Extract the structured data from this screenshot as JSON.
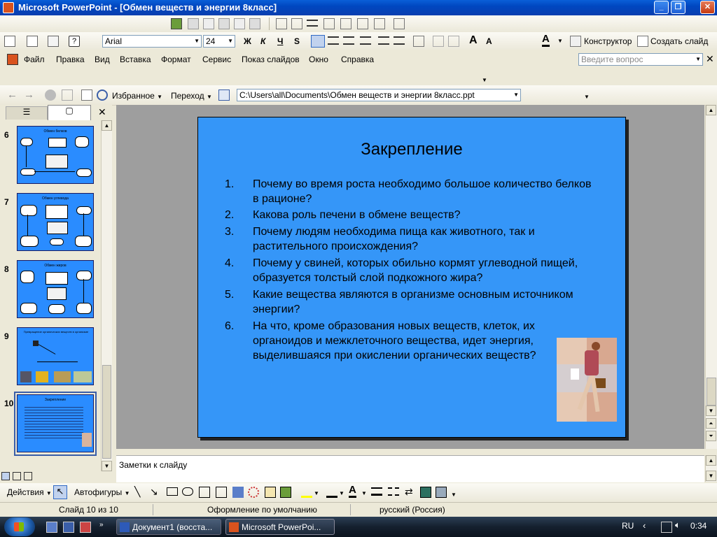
{
  "window": {
    "title": "Microsoft PowerPoint - [Обмен веществ и энергии 8класс]",
    "minimize": "_",
    "restore": "❐",
    "close": "✕"
  },
  "format": {
    "font": "Arial",
    "size": "24",
    "bold": "Ж",
    "italic": "К",
    "underline": "Ч",
    "shadow": "S",
    "design_label": "Конструктор",
    "new_slide_label": "Создать слайд"
  },
  "menu": {
    "items": [
      "Файл",
      "Правка",
      "Вид",
      "Вставка",
      "Формат",
      "Сервис",
      "Показ слайдов",
      "Окно",
      "Справка"
    ],
    "help_placeholder": "Введите вопрос"
  },
  "web": {
    "favorites": "Избранное",
    "go": "Переход",
    "address": "C:\\Users\\all\\Documents\\Обмен веществ и энергии 8класс.ppt"
  },
  "thumbnails": [
    {
      "num": "6",
      "title": "Обмен белков"
    },
    {
      "num": "7",
      "title": "Обмен углевода"
    },
    {
      "num": "8",
      "title": "Обмен жиров"
    },
    {
      "num": "9",
      "title": "Превращение органических веществ в организме"
    },
    {
      "num": "10",
      "title": "Закрепление"
    }
  ],
  "slide": {
    "title": "Закрепление",
    "questions": [
      {
        "num": "1.",
        "text": "Почему во время роста необходимо большое количество белков в рационе?"
      },
      {
        "num": "2.",
        "text": "Какова роль печени в обмене веществ?"
      },
      {
        "num": "3.",
        "text": "Почему людям необходима пища как животного, так и растительного происхождения?"
      },
      {
        "num": "4.",
        "text": "Почему у свиней, которых обильно кормят углеводной пищей, образуется толстый слой подкожного жира?"
      },
      {
        "num": "5.",
        "text": "Какие вещества являются в организме основным источником энергии?"
      },
      {
        "num": "6.",
        "text": "На что, кроме образования новых веществ, клеток, их органоидов и межклеточного вещества, идет энергия, выделившаяся при окислении органических веществ?"
      }
    ]
  },
  "notes": {
    "placeholder": "Заметки к слайду"
  },
  "drawing": {
    "actions": "Действия",
    "autoshapes": "Автофигуры"
  },
  "status": {
    "slide": "Слайд 10 из 10",
    "design": "Оформление по умолчанию",
    "language": "русский (Россия)"
  },
  "taskbar": {
    "tasks": [
      "Документ1 (восста...",
      "Microsoft PowerPoi..."
    ],
    "lang": "RU",
    "time": "0:34"
  },
  "colors": {
    "slide_bg": "#3596f8",
    "title_bar": "#0047c0"
  }
}
